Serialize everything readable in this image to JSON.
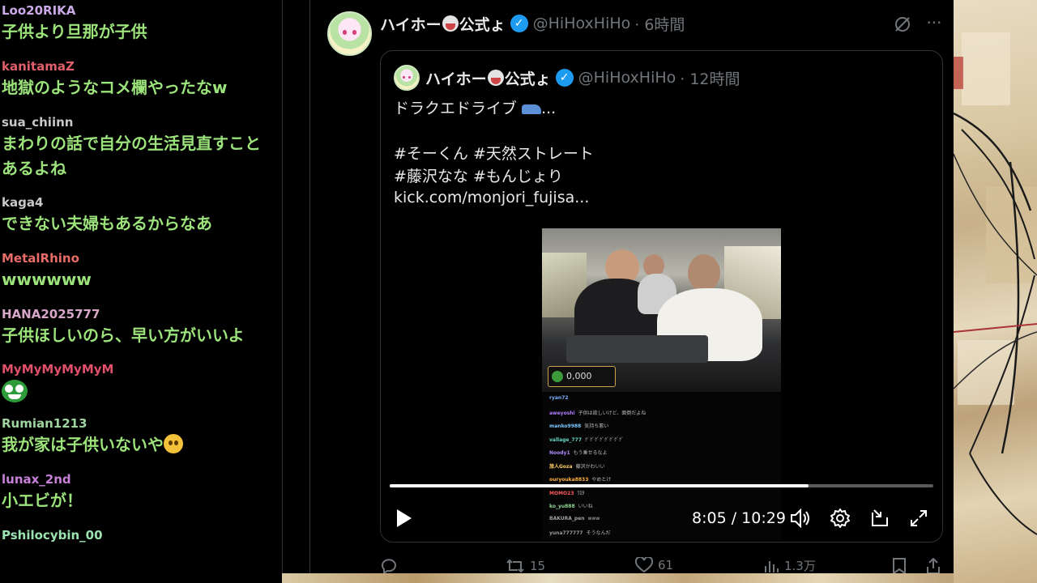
{
  "chat": {
    "messages": [
      {
        "user": "Loo20RIKA",
        "user_color": "#c9a9e8",
        "text": "子供より旦那が子供"
      },
      {
        "user": "kanitamaZ",
        "user_color": "#e05f6a",
        "text": "地獄のようなコメ欄やったなw"
      },
      {
        "user": "sua_chiinn",
        "user_color": "#c8c8c8",
        "text": "まわりの話で自分の生活見直すことあるよね"
      },
      {
        "user": "kaga4",
        "user_color": "#c8c8c8",
        "text": "できない夫婦もあるからなあ"
      },
      {
        "user": "MetalRhino",
        "user_color": "#e76b67",
        "text": "wwwwww"
      },
      {
        "user": "HANA2025777",
        "user_color": "#d8a6c8",
        "text": "子供ほしいのら、早い方がいいよ"
      },
      {
        "user": "MyMyMyMyMyM",
        "user_color": "#e0506a",
        "text": "",
        "emote": "face-emote"
      },
      {
        "user": "Rumian1213",
        "user_color": "#9fd4a0",
        "text": "我が家は子供いないや",
        "emoji": "thinking-emoji"
      },
      {
        "user": "lunax_2nd",
        "user_color": "#c87fd8",
        "text": "小エビが！"
      },
      {
        "user": "Pshilocybin_00",
        "user_color": "#9be3b0",
        "text": ""
      }
    ]
  },
  "tweet": {
    "display_name": "ハイホー",
    "display_name_suffix": "公式ょ",
    "handle": "@HiHoxHiHo",
    "time": "· 6時間",
    "quote": {
      "display_name": "ハイホー",
      "display_name_suffix": "公式ょ",
      "handle": "@HiHoxHiHo",
      "time": "· 12時間",
      "line1": "ドラクエドライブ",
      "line1_suffix": "...",
      "line2": "#そーくん #天然ストレート",
      "line3": "#藤沢なな #もんじょり",
      "link": "kick.com/monjori_fujisa..."
    },
    "video": {
      "donation": "0,000",
      "overlay_chat": [
        {
          "name": "ryan72",
          "color": "#7ab0ff",
          "text": ""
        },
        {
          "name": "aweyoshi",
          "color": "#b07cff",
          "text": "子供は欲しいけど、面倒だよね"
        },
        {
          "name": "manko9988",
          "color": "#7ec8ff",
          "text": "気持ち悪い"
        },
        {
          "name": "vallage_777",
          "color": "#62d6c8",
          "text": "ｸﾞｸﾞｸﾞｸﾞｸﾞｸﾞｸﾞｸﾞ"
        },
        {
          "name": "Noody1",
          "color": "#b48cff",
          "text": "もう乗せるなよ"
        },
        {
          "name": "旅人Goza",
          "color": "#ffd166",
          "text": "藤沢かわいい"
        },
        {
          "name": "ouryouka8833",
          "color": "#ffb347",
          "text": "やめとけ"
        },
        {
          "name": "MOMO23",
          "color": "#ff5a5a",
          "text": "ﾜﾛﾀ"
        },
        {
          "name": "ko_yu888",
          "color": "#8fd694",
          "text": "いいね"
        },
        {
          "name": "BAKURA_pen",
          "color": "#a0a0a0",
          "text": "www"
        },
        {
          "name": "yuna777777",
          "color": "#9a9a9a",
          "text": "そうなんだ"
        }
      ],
      "progress": 0.77,
      "time_display": "8:05 / 10:29"
    },
    "actions": {
      "replies": "",
      "retweets": "15",
      "likes": "61",
      "views": "1.3万"
    }
  }
}
